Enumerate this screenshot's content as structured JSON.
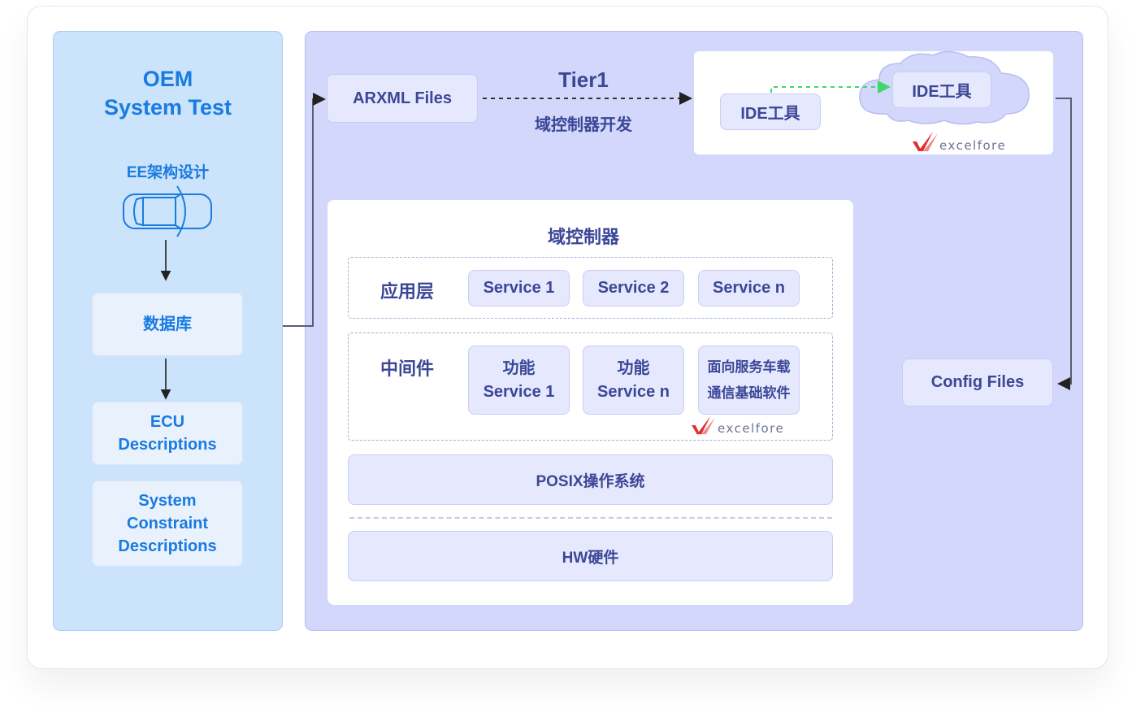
{
  "oem": {
    "title_line1": "OEM",
    "title_line2": "System Test",
    "subtitle": "EE架构设计",
    "car_icon": "car-top-view-icon",
    "boxes": {
      "database": "数据库",
      "ecu_line1": "ECU",
      "ecu_line2": "Descriptions",
      "sys_line1": "System",
      "sys_line2": "Constraint",
      "sys_line3": "Descriptions"
    }
  },
  "tier1": {
    "arxml": "ARXML Files",
    "title": "Tier1",
    "subtitle": "域控制器开发",
    "ide_local": "IDE工具",
    "ide_cloud": "IDE工具",
    "config": "Config Files",
    "logo_text": "excelfore"
  },
  "domain_controller": {
    "title": "域控制器",
    "app_layer": {
      "label": "应用层",
      "services": [
        "Service 1",
        "Service 2",
        "Service n"
      ]
    },
    "middleware": {
      "label": "中间件",
      "items": [
        {
          "line1": "功能",
          "line2": "Service 1"
        },
        {
          "line1": "功能",
          "line2": "Service n"
        },
        {
          "line1": "面向服务车载",
          "line2": "通信基础软件"
        }
      ],
      "logo_text": "excelfore"
    },
    "os": "POSIX操作系统",
    "hw": "HW硬件"
  },
  "colors": {
    "oem_text": "#1a7be0",
    "tier_text": "#3b4797",
    "green_arrow": "#3ed86a",
    "logo_red": "#e0302f"
  }
}
